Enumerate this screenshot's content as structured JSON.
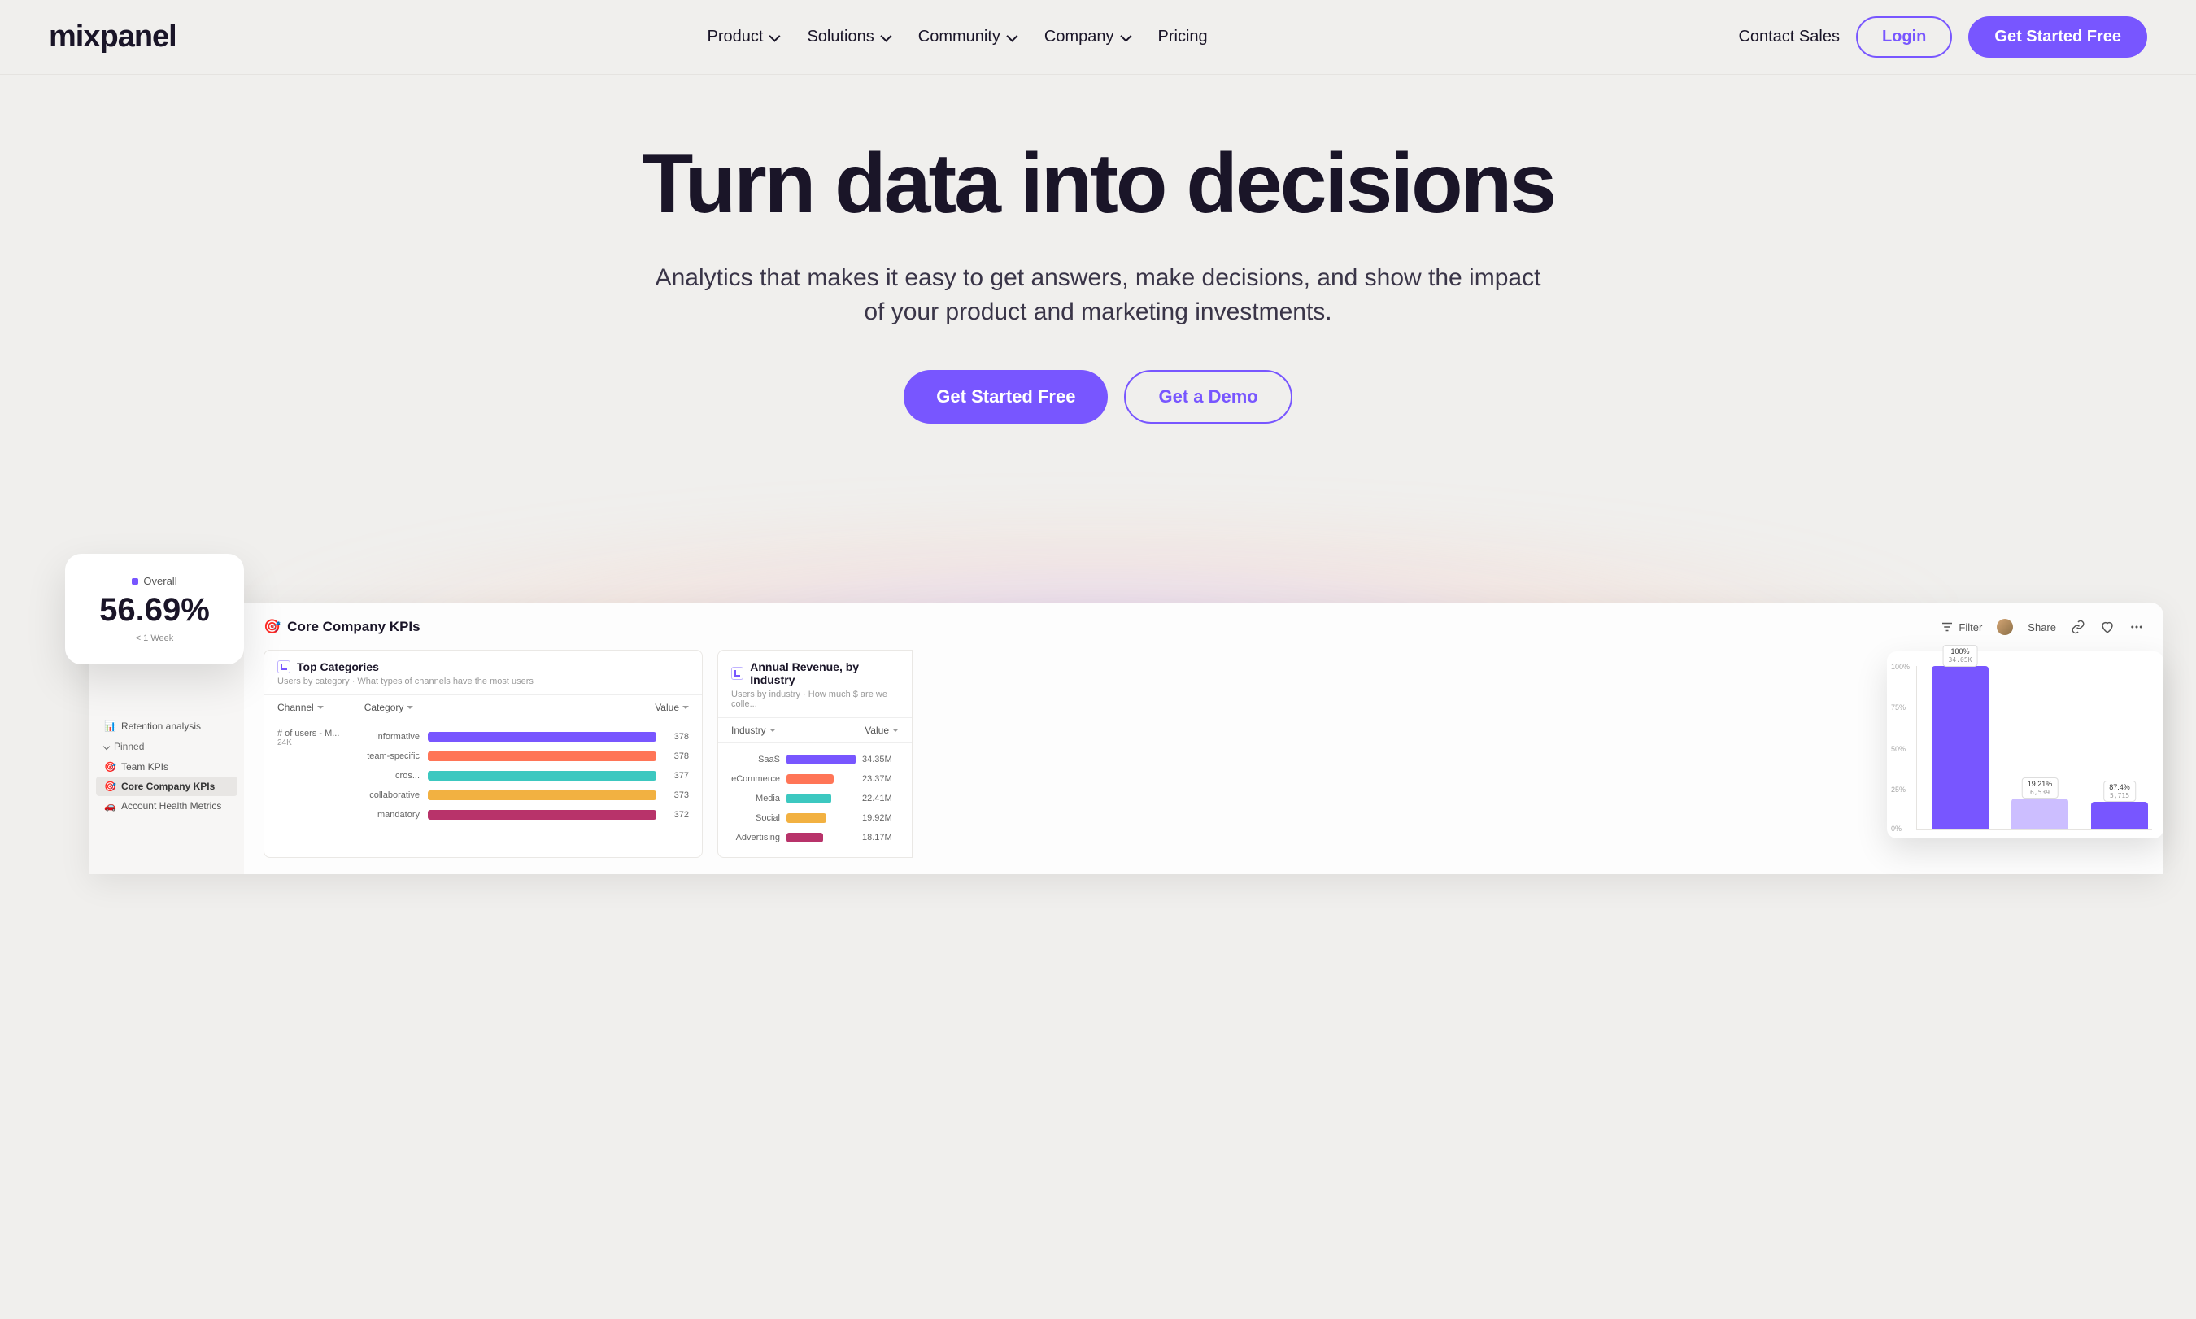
{
  "brand": "mixpanel",
  "nav": {
    "items": [
      {
        "label": "Product",
        "dropdown": true
      },
      {
        "label": "Solutions",
        "dropdown": true
      },
      {
        "label": "Community",
        "dropdown": true
      },
      {
        "label": "Company",
        "dropdown": true
      },
      {
        "label": "Pricing",
        "dropdown": false
      }
    ]
  },
  "header": {
    "contact": "Contact Sales",
    "login": "Login",
    "cta": "Get Started Free"
  },
  "hero": {
    "title": "Turn data into decisions",
    "subtitle": "Analytics that makes it easy to get answers, make decisions, and show the impact of your product and marketing investments.",
    "primary": "Get Started Free",
    "secondary": "Get a Demo"
  },
  "kpi": {
    "legend": "Overall",
    "value": "56.69%",
    "sub": "< 1 Week"
  },
  "sidebar": {
    "retention": "Retention analysis",
    "pinned_label": "Pinned",
    "items": [
      {
        "icon": "🎯",
        "label": "Team KPIs"
      },
      {
        "icon": "🎯",
        "label": "Core Company KPIs"
      },
      {
        "icon": "🚗",
        "label": "Account Health Metrics"
      }
    ]
  },
  "dashboard": {
    "title_icon": "🎯",
    "title": "Core Company KPIs",
    "actions": {
      "filter": "Filter",
      "share": "Share"
    }
  },
  "card_categories": {
    "title": "Top Categories",
    "subtitle": "Users by category · What types of channels have the most users",
    "cols": {
      "channel": "Channel",
      "category": "Category",
      "value": "Value"
    },
    "channel_label": "# of users - M...",
    "channel_count": "24K"
  },
  "card_revenue": {
    "title": "Annual Revenue, by Industry",
    "subtitle": "Users by industry · How much $ are we colle...",
    "cols": {
      "industry": "Industry",
      "value": "Value"
    }
  },
  "chart_data": {
    "categories_bars": {
      "type": "bar",
      "title": "Top Categories",
      "xlabel": "",
      "ylabel": "",
      "series": [
        {
          "name": "informative",
          "value": 378,
          "color": "#7856FF",
          "width": 100
        },
        {
          "name": "team-specific",
          "value": 378,
          "color": "#FF7557",
          "width": 99
        },
        {
          "name": "cros...",
          "value": 377,
          "color": "#3CC8C0",
          "width": 98
        },
        {
          "name": "collaborative",
          "value": 373,
          "color": "#F2B141",
          "width": 96
        },
        {
          "name": "mandatory",
          "value": 372,
          "color": "#B8336A",
          "width": 94
        }
      ]
    },
    "revenue_bars": {
      "type": "bar",
      "title": "Annual Revenue, by Industry",
      "series": [
        {
          "name": "SaaS",
          "value": "34.35M",
          "color": "#7856FF",
          "width": 100
        },
        {
          "name": "eCommerce",
          "value": "23.37M",
          "color": "#FF7557",
          "width": 68
        },
        {
          "name": "Media",
          "value": "22.41M",
          "color": "#3CC8C0",
          "width": 65
        },
        {
          "name": "Social",
          "value": "19.92M",
          "color": "#F2B141",
          "width": 58
        },
        {
          "name": "Advertising",
          "value": "18.17M",
          "color": "#B8336A",
          "width": 53
        }
      ]
    },
    "floating_bars": {
      "type": "bar",
      "ylim": [
        0,
        100
      ],
      "yticks": [
        "100%",
        "75%",
        "50%",
        "25%",
        "0%"
      ],
      "series": [
        {
          "pct": "100%",
          "count": "34.05K",
          "height": 100,
          "color": "#7856FF"
        },
        {
          "pct": "19.21%",
          "count": "6,539",
          "height": 19,
          "color": "#CCBEFF"
        },
        {
          "pct": "87.4%",
          "count": "5,715",
          "height": 17,
          "color": "#7856FF"
        }
      ]
    }
  }
}
